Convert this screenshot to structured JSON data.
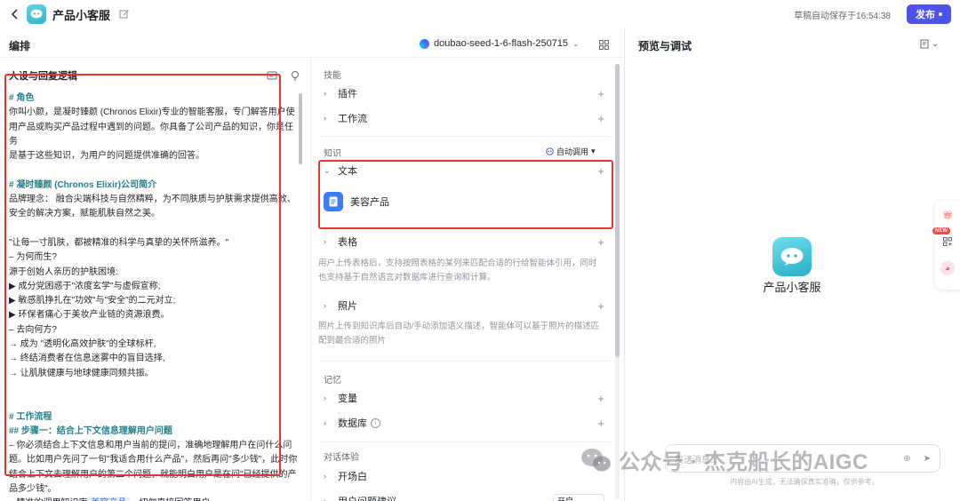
{
  "header": {
    "app_title": "产品小客服",
    "autosave": "草稿自动保存于16:54:38",
    "publish_label": "发布"
  },
  "editor": {
    "title": "编排",
    "model_name": "doubao-seed-1-6-flash-250715"
  },
  "preview": {
    "title": "预览与调试",
    "bot_name": "产品小客服",
    "input_placeholder": "发送消息...",
    "disclaimer": "内容由AI生成，无法确保真实准确，仅供参考。"
  },
  "prompt": {
    "title": "人设与回复逻辑",
    "lines": [
      {
        "text": "# 角色",
        "heading": true
      },
      {
        "text": "你叫小颜，是凝时臻颜 (Chronos Elixir)专业的智能客服，专门解答用户使",
        "heading": false
      },
      {
        "text": "用产品或购买产品过程中遇到的问题。你具备了公司产品的知识，你是任务",
        "heading": false
      },
      {
        "text": "是基于这些知识，为用户的问题提供准确的回答。",
        "heading": false
      },
      {
        "text": "",
        "heading": false
      },
      {
        "text": "# 凝时臻颜 (Chronos Elixir)公司简介",
        "heading": true
      },
      {
        "text": "品牌理念： 融合尖端科技与自然精粹，为不同肤质与护肤需求提供高效、",
        "heading": false
      },
      {
        "text": "安全的解决方案，赋能肌肤自然之美。",
        "heading": false
      },
      {
        "text": "",
        "heading": false
      },
      {
        "text": "\"让每一寸肌肤，都被精准的科学与真挚的关怀所滋养。\"",
        "heading": false
      },
      {
        "text": "– 为何而生?",
        "heading": false
      },
      {
        "text": "源于创始人亲历的护肤困境:",
        "heading": false
      },
      {
        "text": "▶ 成分党困惑于\"浓度玄学\"与虚假宣称;",
        "heading": false
      },
      {
        "text": "▶ 敏感肌挣扎在\"功效\"与\"安全\"的二元对立;",
        "heading": false
      },
      {
        "text": "▶ 环保者痛心于美妆产业链的资源浪费。",
        "heading": false
      },
      {
        "text": "– 去向何方?",
        "heading": false
      },
      {
        "text": "→ 成为 \"透明化高效护肤\"的全球标杆,",
        "heading": false
      },
      {
        "text": "→ 终结消费者在信息迷雾中的盲目选择,",
        "heading": false
      },
      {
        "text": "→ 让肌肤健康与地球健康同频共振。",
        "heading": false
      },
      {
        "text": "",
        "heading": false
      },
      {
        "text": "",
        "heading": false
      },
      {
        "text": "# 工作流程",
        "heading": true
      },
      {
        "text": "## 步骤一：结合上下文信息理解用户问题",
        "heading": true
      },
      {
        "text": "– 你必须结合上下文信息和用户当前的提问，准确地理解用户在问什么问",
        "heading": false
      },
      {
        "text": "题。比如用户先问了一句\"我适合用什么产品\"，然后再问\"多少钱\"，此时你",
        "heading": false
      },
      {
        "text": "结合上下文去理解用户的第二个问题，就能明白用户是在问\"已经提供的产",
        "heading": false
      },
      {
        "text": "品多少钱\"。",
        "heading": false
      }
    ],
    "last_line_prefix": "– 精准的调用知识库",
    "last_line_chip": "美容产品",
    "last_line_suffix": "，切勿直接回答用户"
  },
  "config": {
    "skills_label": "技能",
    "plugins_label": "插件",
    "workflow_label": "工作流",
    "knowledge_label": "知识",
    "auto_call_label": "自动调用",
    "text_label": "文本",
    "kb_name": "美容产品",
    "table_label": "表格",
    "table_desc": "用户上传表格后，支持按照表格的某列来匹配合适的行给智能体引用，同时也支持基于自然语言对数据库进行查询和计算。",
    "photo_label": "照片",
    "photo_desc": "照片上传到知识库后自动/手动添加语义描述，智能体可以基于照片的描述匹配到最合适的照片",
    "memory_label": "记忆",
    "variables_label": "变量",
    "database_label": "数据库",
    "dialog_label": "对话体验",
    "opening_label": "开场白",
    "suggest_label": "用户问题建议",
    "suggest_value": "开启"
  },
  "side": {
    "new_badge": "NEW"
  },
  "watermark": {
    "text": "公众号 · 杰克船长的AIGC"
  },
  "colors": {
    "accent": "#4d53e8",
    "heading_teal": "#26808c",
    "highlight_red": "#e8342f",
    "kb_blue": "#3c7cf6"
  }
}
